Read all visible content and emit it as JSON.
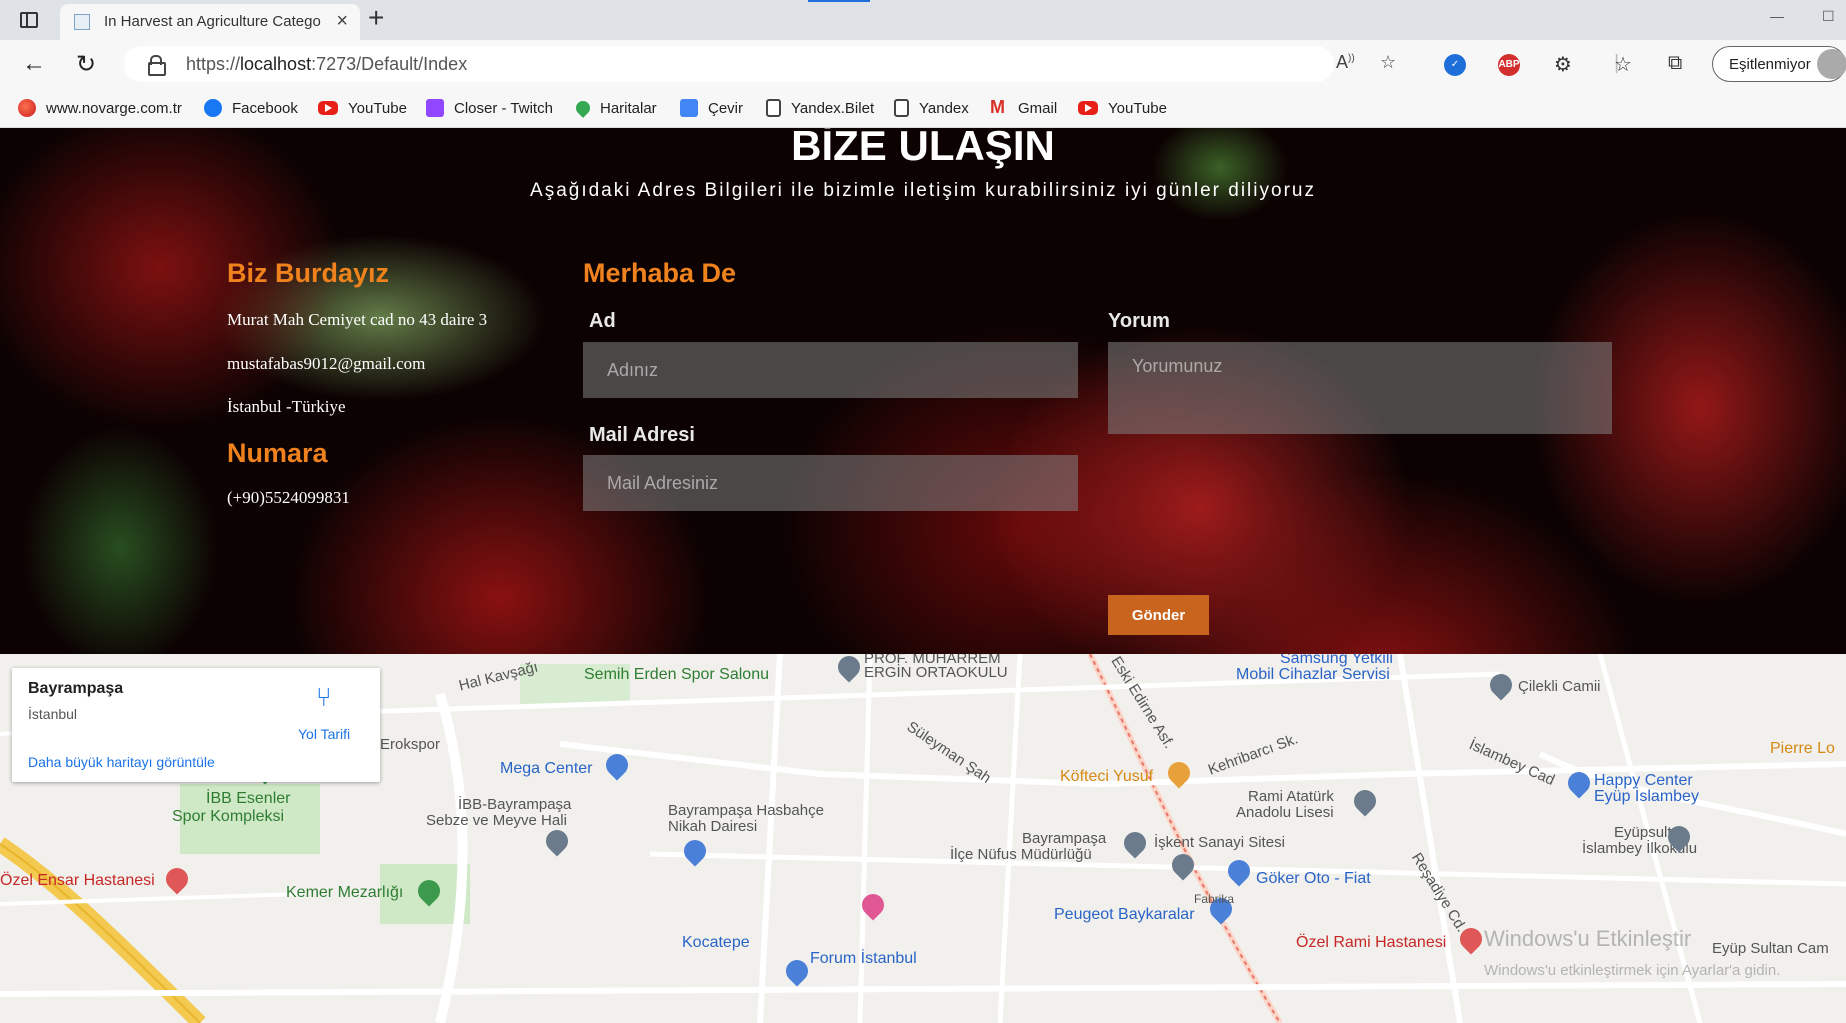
{
  "browser": {
    "tab_title": "In Harvest an Agriculture Catego",
    "url_prefix": "https://",
    "url_host": "localhost",
    "url_rest": ":7273/Default/Index",
    "sync_button": "Eşitlenmiyor",
    "ext_abp": "ABP",
    "bookmarks": [
      {
        "label": "www.novarge.com.tr",
        "icon": "novarge-icon"
      },
      {
        "label": "Facebook",
        "icon": "facebook-icon"
      },
      {
        "label": "YouTube",
        "icon": "youtube-icon"
      },
      {
        "label": "Closer - Twitch",
        "icon": "twitch-icon"
      },
      {
        "label": "Haritalar",
        "icon": "maps-icon"
      },
      {
        "label": "Çevir",
        "icon": "translate-icon"
      },
      {
        "label": "Yandex.Bilet",
        "icon": "page-icon"
      },
      {
        "label": "Yandex",
        "icon": "page-icon"
      },
      {
        "label": "Gmail",
        "icon": "gmail-icon"
      },
      {
        "label": "YouTube",
        "icon": "youtube-icon"
      }
    ]
  },
  "contact": {
    "title": "BİZE ULAŞIN",
    "subtitle": "Aşağıdaki Adres Bilgileri ile bizimle iletişim kurabilirsiniz iyi günler diliyoruz",
    "here_heading": "Biz Burdayız",
    "address": "Murat Mah Cemiyet cad no 43 daire 3",
    "email": "mustafabas9012@gmail.com",
    "city": "İstanbul -Türkiye",
    "number_heading": "Numara",
    "phone": "(+90)5524099831",
    "form_heading": "Merhaba De",
    "name_label": "Ad",
    "name_placeholder": "Adınız",
    "mail_label": "Mail Adresi",
    "mail_placeholder": "Mail Adresiniz",
    "comment_label": "Yorum",
    "comment_placeholder": "Yorumunuz",
    "send_label": "Gönder"
  },
  "map": {
    "card_name": "Bayrampaşa",
    "card_city": "İstanbul",
    "card_link": "Daha büyük haritayı görüntüle",
    "card_directions": "Yol Tarifi",
    "labels": {
      "hal_kavsagi": "Hal Kavşağı",
      "semih_erden": "Semih Erden Spor Salonu",
      "prof_muharrem": "PROF. MUHARREM",
      "ergin": "ERGİN ORTAOKULU",
      "samsung": "Samsung Yetkili",
      "mobil": "Mobil Cihazlar Servisi",
      "cilekli": "Çilekli Camii",
      "mega": "Mega Center",
      "erokspor": "Erokspor",
      "ibb_esenler_1": "İBB Esenler",
      "ibb_esenler_2": "Spor Kompleksi",
      "ibb_bay_1": "İBB-Bayrampaşa",
      "ibb_bay_2": "Sebze ve Meyve Hali",
      "hasbahce_1": "Bayrampaşa Hasbahçe",
      "hasbahce_2": "Nikah Dairesi",
      "kofteci": "Köfteci Yusuf",
      "rami_1": "Rami Atatürk",
      "rami_2": "Anadolu Lisesi",
      "nufus_1": "Bayrampaşa",
      "nufus_2": "İlçe Nüfus Müdürlüğü",
      "iskent": "İşkent Sanayi Sitesi",
      "goker": "Göker Oto - Fiat",
      "ozel_ensar": "Özel Ensar Hastanesi",
      "kemer": "Kemer Mezarlığı",
      "peugeot": "Peugeot Baykaralar",
      "ozel_rami": "Özel Rami Hastanesi",
      "kocatepe": "Kocatepe",
      "forum": "Forum İstanbul",
      "happy_1": "Happy Center",
      "happy_2": "Eyüp İslambey",
      "eyupsultan_1": "Eyüpsultan",
      "eyupsultan_2": "İslambey İlkokulu",
      "eyup_sultan_cam": "Eyüp Sultan Cam",
      "pierre": "Pierre Lo",
      "islambey": "İslambey Cad",
      "suleyman": "Süleyman Şah",
      "fabrika": "Fabrika",
      "kehribarci": "Kehribarcı Sk.",
      "eski_edirne": "Eski Edirne Asf.",
      "resadiye": "Reşadiye Cd."
    }
  },
  "watermark": {
    "line1": "Windows'u Etkinleştir",
    "line2": "Windows'u etkinleştirmek için Ayarlar'a gidin."
  },
  "colors": {
    "accent_orange": "#f0821e",
    "button": "#c8641e",
    "link_blue": "#1a73e8"
  }
}
